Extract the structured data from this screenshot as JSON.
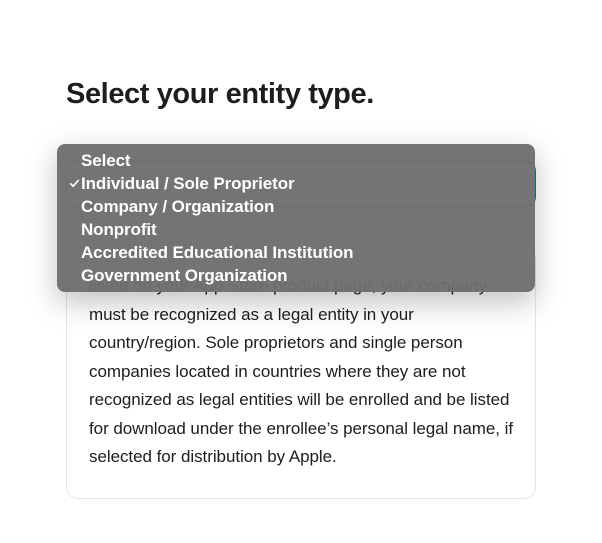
{
  "page": {
    "title": "Select your entity type."
  },
  "select": {
    "placeholder_label": "Select",
    "options": [
      {
        "label": "Select",
        "selected": false
      },
      {
        "label": "Individual / Sole Proprietor",
        "selected": true
      },
      {
        "label": "Company / Organization",
        "selected": false
      },
      {
        "label": "Nonprofit",
        "selected": false
      },
      {
        "label": "Accredited Educational Institution",
        "selected": false
      },
      {
        "label": "Government Organization",
        "selected": false
      }
    ]
  },
  "info_card": {
    "body": "listed on your App Store product page, your company must be recognized as a legal entity in your country/region. Sole proprietors and single person companies located in countries where they are not recognized as legal entities will be enrolled and be listed for download under the enrollee’s personal legal name, if selected for distribution by Apple."
  },
  "colors": {
    "accent": "#0071e3",
    "dropdown_bg": "rgba(110,110,110,0.96)",
    "text": "#1d1d1f",
    "card_border": "#e5e5e7"
  }
}
